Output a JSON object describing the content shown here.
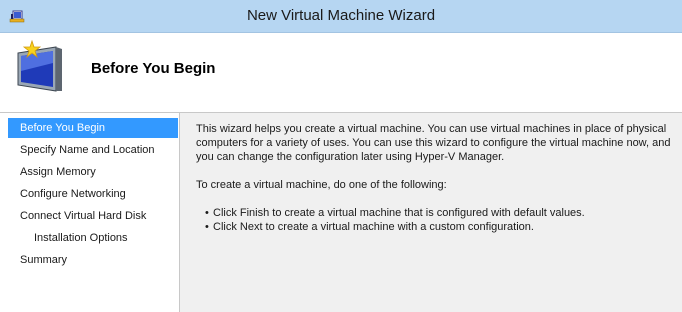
{
  "window": {
    "title": "New Virtual Machine Wizard",
    "icon": "hyper-v-manager-icon"
  },
  "header": {
    "title": "Before You Begin",
    "icon": "new-virtual-machine-icon"
  },
  "nav": {
    "items": [
      {
        "label": "Before You Begin",
        "selected": true
      },
      {
        "label": "Specify Name and Location"
      },
      {
        "label": "Assign Memory"
      },
      {
        "label": "Configure Networking"
      },
      {
        "label": "Connect Virtual Hard Disk"
      },
      {
        "label": "Installation Options",
        "indented": true
      },
      {
        "label": "Summary"
      }
    ]
  },
  "content": {
    "intro_line1": "This wizard helps you create a virtual machine. You can use virtual machines in place of physical",
    "intro_line2": "computers for a variety of uses. You can use this wizard to configure the virtual machine now, and",
    "intro_line3": "you can change the configuration later using Hyper-V Manager.",
    "instruction": "To create a virtual machine, do one of the following:",
    "bullets": [
      "Click Finish to create a virtual machine that is configured with default values.",
      "Click Next to create a virtual machine with a custom configuration."
    ]
  },
  "colors": {
    "titlebar": "#b6d6f2",
    "selection": "#3399ff",
    "background": "#f0f0f0"
  }
}
